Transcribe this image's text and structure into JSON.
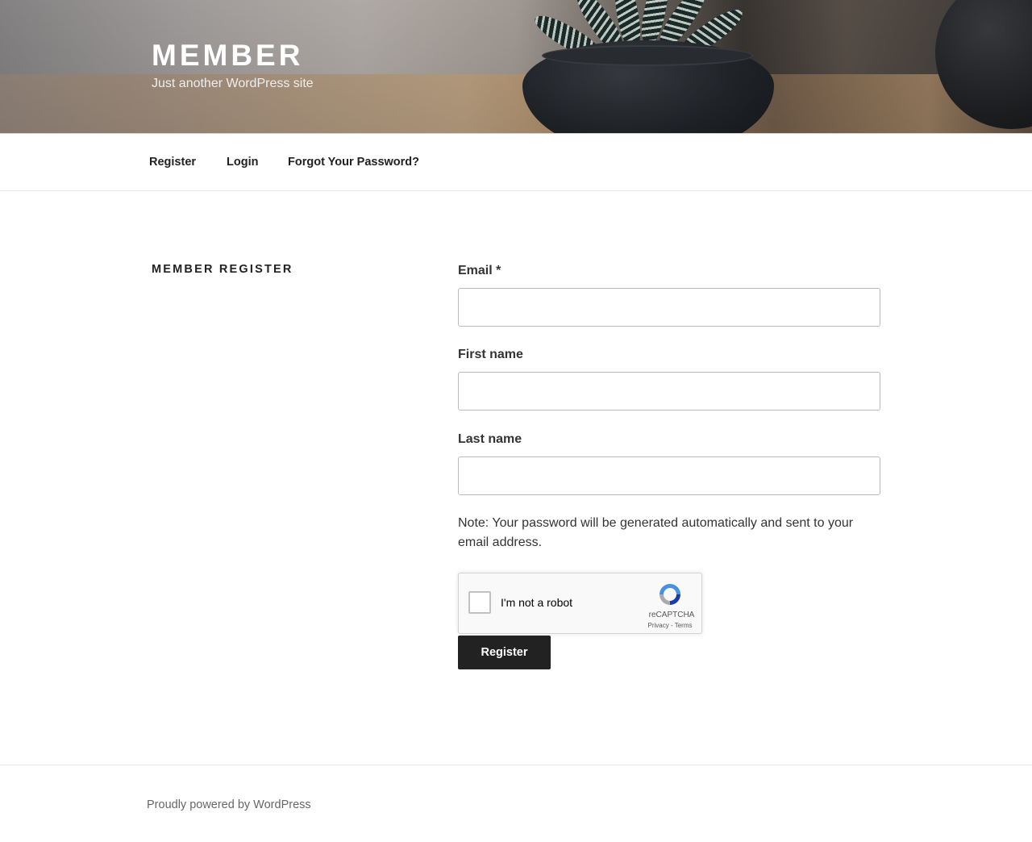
{
  "header": {
    "site_title": "MEMBER",
    "site_description": "Just another WordPress site"
  },
  "nav": {
    "items": [
      {
        "label": "Register"
      },
      {
        "label": "Login"
      },
      {
        "label": "Forgot Your Password?"
      }
    ]
  },
  "main": {
    "heading": "MEMBER REGISTER",
    "form": {
      "email_label": "Email *",
      "email_value": "",
      "first_name_label": "First name",
      "first_name_value": "",
      "last_name_label": "Last name",
      "last_name_value": "",
      "note": "Note: Your password will be generated automatically and sent to your email address.",
      "captcha": {
        "label": "I'm not a robot",
        "brand": "reCAPTCHA",
        "links": "Privacy - Terms",
        "checked": false
      },
      "submit_label": "Register"
    }
  },
  "footer": {
    "text": "Proudly powered by WordPress"
  },
  "colors": {
    "text": "#222222",
    "button_bg": "#222222",
    "button_text": "#ffffff",
    "border": "#bbbbbb"
  }
}
